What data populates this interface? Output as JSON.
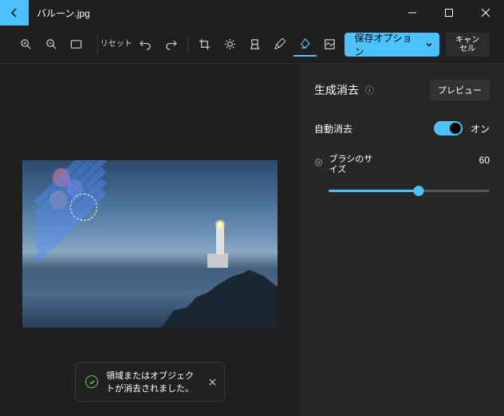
{
  "titlebar": {
    "filename": "バルーン.jpg"
  },
  "toolbar": {
    "reset_label": "リセット",
    "save_label": "保存オプション",
    "cancel_label": "キャンセル"
  },
  "panel": {
    "title": "生成消去",
    "preview_label": "プレビュー",
    "auto_erase_label": "自動消去",
    "auto_erase_state": "オン",
    "brush_label": "ブラシのサイズ",
    "brush_value": "60"
  },
  "toast": {
    "message": "領域またはオブジェクトが消去されました。"
  }
}
